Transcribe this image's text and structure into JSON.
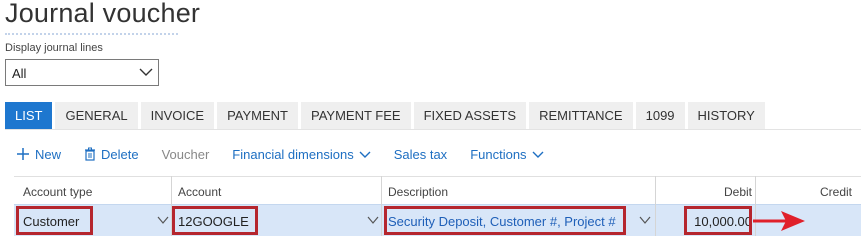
{
  "page": {
    "title": "Journal voucher",
    "filter_label": "Display journal lines",
    "filter_value": "All"
  },
  "tabs": [
    {
      "label": "LIST",
      "active": true
    },
    {
      "label": "GENERAL"
    },
    {
      "label": "INVOICE"
    },
    {
      "label": "PAYMENT"
    },
    {
      "label": "PAYMENT FEE"
    },
    {
      "label": "FIXED ASSETS"
    },
    {
      "label": "REMITTANCE"
    },
    {
      "label": "1099"
    },
    {
      "label": "HISTORY"
    }
  ],
  "toolbar": {
    "new_label": "New",
    "delete_label": "Delete",
    "voucher_label": "Voucher",
    "financial_dimensions_label": "Financial dimensions",
    "sales_tax_label": "Sales tax",
    "functions_label": "Functions"
  },
  "grid": {
    "headers": {
      "account_type": "Account type",
      "account": "Account",
      "description": "Description",
      "debit": "Debit",
      "credit": "Credit"
    },
    "row": {
      "account_type": "Customer",
      "account": "12GOOGLE",
      "description": "Security Deposit, Customer #, Project #",
      "debit": "10,000.00",
      "credit": ""
    }
  },
  "colors": {
    "accent": "#1e77cf",
    "link": "#1e6fc2",
    "row_selected": "#d8e6f8",
    "highlight_box": "#b5262e",
    "arrow": "#e0202a"
  },
  "icons": {
    "new": "plus-icon",
    "delete": "trash-icon",
    "dropdown": "chevron-down-icon",
    "annotation": "red-arrow-icon"
  }
}
